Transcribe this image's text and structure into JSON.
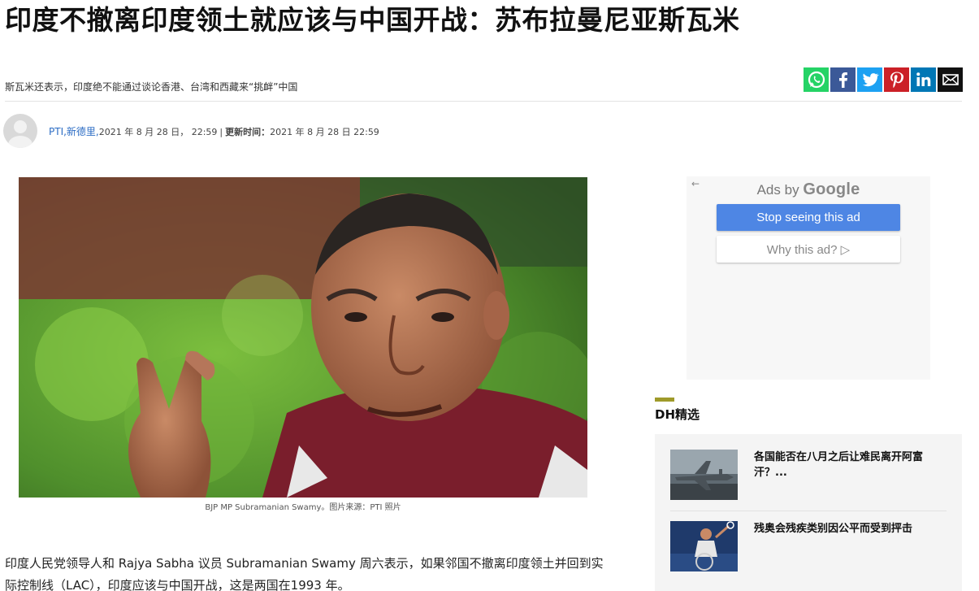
{
  "article": {
    "headline": "印度不撤离印度领土就应该与中国开战：苏布拉曼尼亚斯瓦米",
    "subhead": "斯瓦米还表示，印度绝不能通过谈论香港、台湾和西藏来“挑衅”中国",
    "author": "PTI,新德里,",
    "published": "2021 年 8 月 28 日， 22:59",
    "updated_label": "更新时间：",
    "updated": "2021 年 8 月 28 日 22:59",
    "photo_caption": "BJP MP Subramanian Swamy。图片来源：PTI 照片",
    "body_paragraph": "印度人民党领导人和 Rajya Sabha 议员 Subramanian Swamy 周六表示，如果邻国不撤离印度领土并回到实际控制线（LAC），印度应该与中国开战，这是两国在1993 年。"
  },
  "share": {
    "buttons": [
      {
        "name": "whatsapp",
        "color": "#25d366"
      },
      {
        "name": "facebook",
        "color": "#3b5998"
      },
      {
        "name": "twitter",
        "color": "#1da1f2"
      },
      {
        "name": "pinterest",
        "color": "#cb2027"
      },
      {
        "name": "linkedin",
        "color": "#0077b5"
      },
      {
        "name": "email",
        "color": "#111111"
      }
    ]
  },
  "ad": {
    "back_arrow": "←",
    "ads_by": "Ads by",
    "brand": "Google",
    "stop_label": "Stop seeing this ad",
    "why_label": "Why this ad? ▷"
  },
  "dh_picks": {
    "title": "DH精选",
    "items": [
      {
        "title": "各国能否在八月之后让难民离开阿富汗？..."
      },
      {
        "title": "残奥会残疾类别因公平而受到抨击"
      }
    ]
  }
}
